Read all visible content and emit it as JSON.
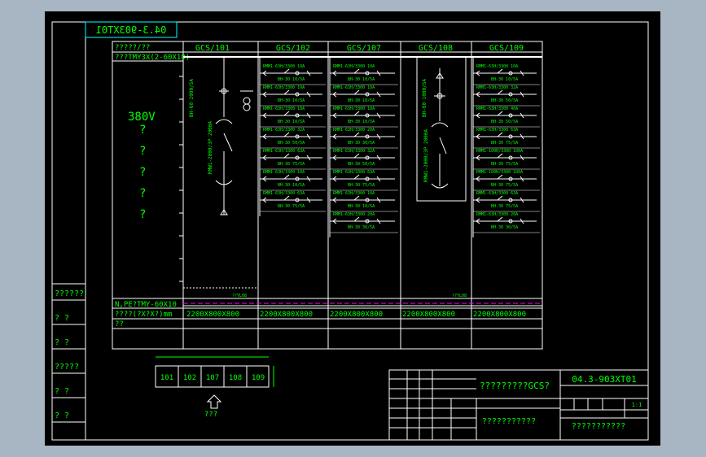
{
  "drawing_no_mirrored": "04.3-903XT01",
  "header_row_label": "?????/??",
  "busbar_label": "???TMY3X(2-60X10)",
  "voltage": "380V",
  "question_marks": [
    "?",
    "?",
    "?",
    "?",
    "?"
  ],
  "panels": [
    {
      "id": "GCS/101",
      "dims": "2200X800X800"
    },
    {
      "id": "GCS/102",
      "dims": "2200X800X800"
    },
    {
      "id": "GCS/107",
      "dims": "2200X800X800"
    },
    {
      "id": "GCS/108",
      "dims": "2200X800X800"
    },
    {
      "id": "GCS/109",
      "dims": "2200X800X800"
    }
  ],
  "n_pe_label": "N,PE?TMY-60X10",
  "dims_label": "????(?X?X?)mm",
  "remark_label": "??",
  "left_column_labels": [
    "??????",
    "?  ?",
    "?  ?",
    "?????",
    "?  ?",
    "?  ?"
  ],
  "layout_boxes": [
    "101",
    "102",
    "107",
    "108",
    "109"
  ],
  "arrow_caption": "???",
  "title_block": {
    "title": "?????????GCS?",
    "drawing_no": "04.3-903XT01",
    "subtitle": "???????????",
    "company": "???????????",
    "scale": "1:1"
  },
  "breaker_labels": {
    "p102": [
      "RMM1-63H/3300 10A",
      "RMM1-63H/3300 10A",
      "RMM1-63H/3300 10A",
      "RMM1-63H/3300 32A",
      "RMM1-63H/3300 63A",
      "RMM1-63H/3300 10A",
      "RMM1-63H/3300 63A"
    ],
    "p107": [
      "RMM1-63H/3300 10A",
      "RMM1-63H/3300 10A",
      "RMM1-63H/3300 10A",
      "RMM1-63H/3300 20A",
      "RMM1-63H/3300 32A",
      "RMM1-63H/3300 63A",
      "RMM1-63H/3300 10A",
      "RMM1-63H/3300 20A"
    ],
    "p109": [
      "RMM1-63H/3300 10A",
      "RMM1-63H/3300 32A",
      "RMM1-63H/3300 40A",
      "RMM1-63H/3300 63A",
      "RMM1-100H/3300 100A",
      "RMM1-100H/3300 100A",
      "RMM1-63H/3300 63A",
      "RMM1-63H/3300 20A"
    ]
  },
  "ct_labels": {
    "p102": [
      "BH-30 10/5A",
      "BH-30 10/5A",
      "BH-30 10/5A",
      "BH-30 50/5A",
      "BH-30 75/5A",
      "BH-30 10/5A",
      "BH-30 75/5A"
    ],
    "p107": [
      "BH-30 10/5A",
      "BH-30 10/5A",
      "BH-30 10/5A",
      "BH-30 30/5A",
      "BH-30 50/5A",
      "BH-30 75/5A",
      "BH-30 10/5A",
      "BH-30 30/5A"
    ],
    "p109": [
      "BH-30 10/5A",
      "BH-30 50/5A",
      "BH-30 50/5A",
      "BH-30 75/5A",
      "BH-30 75/5A",
      "BH-30 75/5A",
      "BH-30 75/5A",
      "BH-30 30/5A"
    ]
  },
  "feed_labels": {
    "p101_top": "BH-60 2000/5A",
    "p101_switch": "RMW1-2000/3P 2000A",
    "p108_top": "BH-60 1000/5A",
    "p108_switch": "RMW1-2000/3P 2000A"
  },
  "small_tags": [
    "??YL08",
    "??YL08"
  ],
  "colors": {
    "frame": "#ffffff",
    "text": "#00ff00",
    "grid": "#ffffff",
    "busbar_pe": "#ff00ff",
    "symbol": "#ffffff",
    "cyan": "#00ffff"
  }
}
